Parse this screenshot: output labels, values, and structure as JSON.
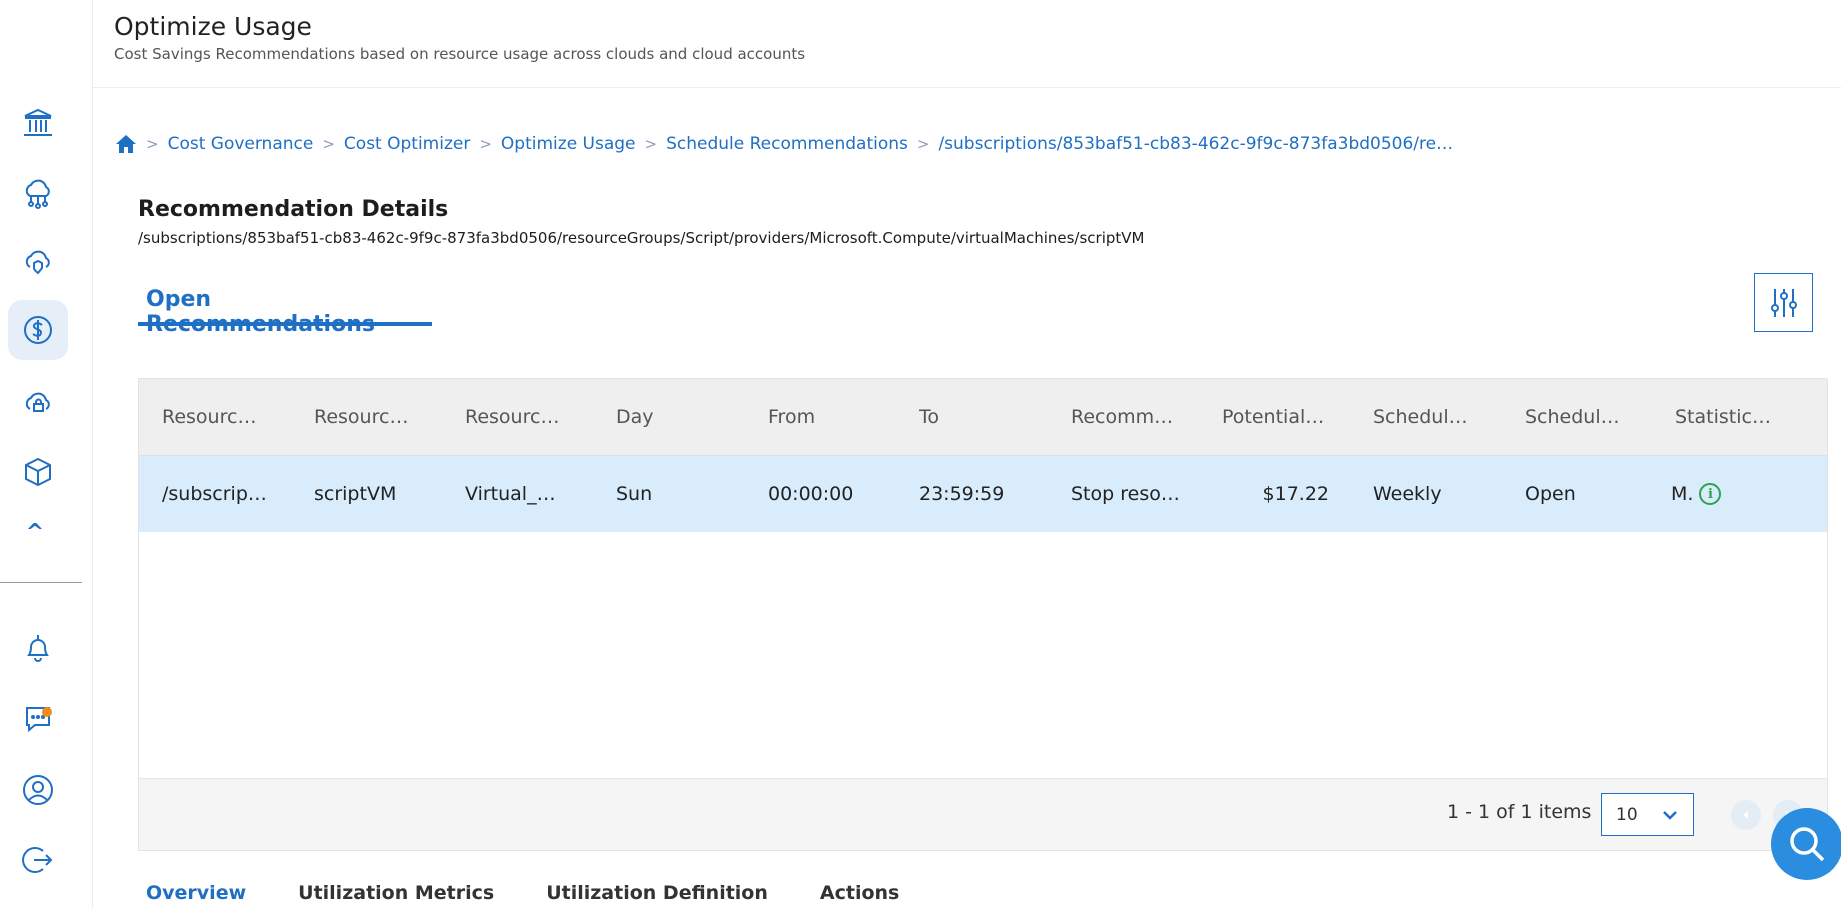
{
  "header": {
    "title": "Optimize Usage",
    "subtitle": "Cost Savings Recommendations based on resource usage across clouds and cloud accounts"
  },
  "sidebar": {
    "items": [
      {
        "icon": "bank-icon",
        "label": ""
      },
      {
        "icon": "cloud-network-icon",
        "label": ""
      },
      {
        "icon": "cloud-shield-icon",
        "label": ""
      },
      {
        "icon": "dollar-icon",
        "label": "",
        "active": true
      },
      {
        "icon": "cloud-lock-icon",
        "label": ""
      },
      {
        "icon": "cube-icon",
        "label": ""
      }
    ],
    "collapse": "^",
    "bottom": [
      "bell-icon",
      "chat-icon",
      "user-icon",
      "logout-icon"
    ]
  },
  "breadcrumb": {
    "items": [
      "Cost Governance",
      "Cost Optimizer",
      "Optimize Usage",
      "Schedule Recommendations",
      "/subscriptions/853baf51-cb83-462c-9f9c-873fa3bd0506/reso…"
    ]
  },
  "details": {
    "title": "Recommendation Details",
    "path": "/subscriptions/853baf51-cb83-462c-9f9c-873fa3bd0506/resourceGroups/Script/providers/Microsoft.Compute/virtualMachines/scriptVM"
  },
  "tabs": {
    "open": "Open Recommendations"
  },
  "table": {
    "columns": [
      "Resourc…",
      "Resourc…",
      "Resourc…",
      "Day",
      "From",
      "To",
      "Recomm…",
      "Potential…",
      "Schedul…",
      "Schedul…",
      "Statistic…"
    ],
    "rows": [
      {
        "resource_id": "/subscrip…",
        "resource_name": "scriptVM",
        "resource_type": "Virtual_…",
        "day": "Sun",
        "from": "00:00:00",
        "to": "23:59:59",
        "recommendation": "Stop reso…",
        "potential": "$17.22",
        "schedule": "Weekly",
        "status": "Open",
        "statistic": "M."
      }
    ]
  },
  "pager": {
    "info": "1 - 1 of 1 items",
    "page_size": "10"
  },
  "bottom_tabs": [
    "Overview",
    "Utilization Metrics",
    "Utilization Definition",
    "Actions"
  ],
  "colors": {
    "accent": "#1f6fc5",
    "row_selected": "#d8ecfb",
    "notification": "#f28a1c",
    "info_green": "#2fa24e",
    "fab": "#2b8de0"
  }
}
